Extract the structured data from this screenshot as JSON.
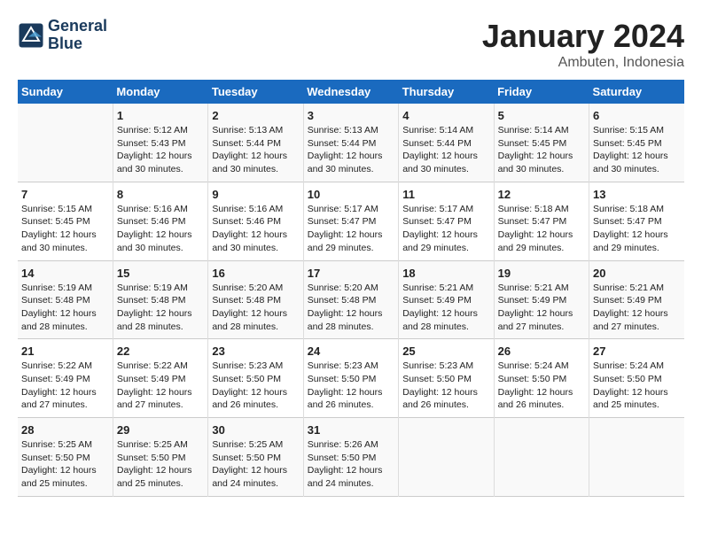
{
  "header": {
    "logo_line1": "General",
    "logo_line2": "Blue",
    "month": "January 2024",
    "location": "Ambuten, Indonesia"
  },
  "weekdays": [
    "Sunday",
    "Monday",
    "Tuesday",
    "Wednesday",
    "Thursday",
    "Friday",
    "Saturday"
  ],
  "weeks": [
    [
      {
        "day": "",
        "info": ""
      },
      {
        "day": "1",
        "info": "Sunrise: 5:12 AM\nSunset: 5:43 PM\nDaylight: 12 hours\nand 30 minutes."
      },
      {
        "day": "2",
        "info": "Sunrise: 5:13 AM\nSunset: 5:44 PM\nDaylight: 12 hours\nand 30 minutes."
      },
      {
        "day": "3",
        "info": "Sunrise: 5:13 AM\nSunset: 5:44 PM\nDaylight: 12 hours\nand 30 minutes."
      },
      {
        "day": "4",
        "info": "Sunrise: 5:14 AM\nSunset: 5:44 PM\nDaylight: 12 hours\nand 30 minutes."
      },
      {
        "day": "5",
        "info": "Sunrise: 5:14 AM\nSunset: 5:45 PM\nDaylight: 12 hours\nand 30 minutes."
      },
      {
        "day": "6",
        "info": "Sunrise: 5:15 AM\nSunset: 5:45 PM\nDaylight: 12 hours\nand 30 minutes."
      }
    ],
    [
      {
        "day": "7",
        "info": "Sunrise: 5:15 AM\nSunset: 5:45 PM\nDaylight: 12 hours\nand 30 minutes."
      },
      {
        "day": "8",
        "info": "Sunrise: 5:16 AM\nSunset: 5:46 PM\nDaylight: 12 hours\nand 30 minutes."
      },
      {
        "day": "9",
        "info": "Sunrise: 5:16 AM\nSunset: 5:46 PM\nDaylight: 12 hours\nand 30 minutes."
      },
      {
        "day": "10",
        "info": "Sunrise: 5:17 AM\nSunset: 5:47 PM\nDaylight: 12 hours\nand 29 minutes."
      },
      {
        "day": "11",
        "info": "Sunrise: 5:17 AM\nSunset: 5:47 PM\nDaylight: 12 hours\nand 29 minutes."
      },
      {
        "day": "12",
        "info": "Sunrise: 5:18 AM\nSunset: 5:47 PM\nDaylight: 12 hours\nand 29 minutes."
      },
      {
        "day": "13",
        "info": "Sunrise: 5:18 AM\nSunset: 5:47 PM\nDaylight: 12 hours\nand 29 minutes."
      }
    ],
    [
      {
        "day": "14",
        "info": "Sunrise: 5:19 AM\nSunset: 5:48 PM\nDaylight: 12 hours\nand 28 minutes."
      },
      {
        "day": "15",
        "info": "Sunrise: 5:19 AM\nSunset: 5:48 PM\nDaylight: 12 hours\nand 28 minutes."
      },
      {
        "day": "16",
        "info": "Sunrise: 5:20 AM\nSunset: 5:48 PM\nDaylight: 12 hours\nand 28 minutes."
      },
      {
        "day": "17",
        "info": "Sunrise: 5:20 AM\nSunset: 5:48 PM\nDaylight: 12 hours\nand 28 minutes."
      },
      {
        "day": "18",
        "info": "Sunrise: 5:21 AM\nSunset: 5:49 PM\nDaylight: 12 hours\nand 28 minutes."
      },
      {
        "day": "19",
        "info": "Sunrise: 5:21 AM\nSunset: 5:49 PM\nDaylight: 12 hours\nand 27 minutes."
      },
      {
        "day": "20",
        "info": "Sunrise: 5:21 AM\nSunset: 5:49 PM\nDaylight: 12 hours\nand 27 minutes."
      }
    ],
    [
      {
        "day": "21",
        "info": "Sunrise: 5:22 AM\nSunset: 5:49 PM\nDaylight: 12 hours\nand 27 minutes."
      },
      {
        "day": "22",
        "info": "Sunrise: 5:22 AM\nSunset: 5:49 PM\nDaylight: 12 hours\nand 27 minutes."
      },
      {
        "day": "23",
        "info": "Sunrise: 5:23 AM\nSunset: 5:50 PM\nDaylight: 12 hours\nand 26 minutes."
      },
      {
        "day": "24",
        "info": "Sunrise: 5:23 AM\nSunset: 5:50 PM\nDaylight: 12 hours\nand 26 minutes."
      },
      {
        "day": "25",
        "info": "Sunrise: 5:23 AM\nSunset: 5:50 PM\nDaylight: 12 hours\nand 26 minutes."
      },
      {
        "day": "26",
        "info": "Sunrise: 5:24 AM\nSunset: 5:50 PM\nDaylight: 12 hours\nand 26 minutes."
      },
      {
        "day": "27",
        "info": "Sunrise: 5:24 AM\nSunset: 5:50 PM\nDaylight: 12 hours\nand 25 minutes."
      }
    ],
    [
      {
        "day": "28",
        "info": "Sunrise: 5:25 AM\nSunset: 5:50 PM\nDaylight: 12 hours\nand 25 minutes."
      },
      {
        "day": "29",
        "info": "Sunrise: 5:25 AM\nSunset: 5:50 PM\nDaylight: 12 hours\nand 25 minutes."
      },
      {
        "day": "30",
        "info": "Sunrise: 5:25 AM\nSunset: 5:50 PM\nDaylight: 12 hours\nand 24 minutes."
      },
      {
        "day": "31",
        "info": "Sunrise: 5:26 AM\nSunset: 5:50 PM\nDaylight: 12 hours\nand 24 minutes."
      },
      {
        "day": "",
        "info": ""
      },
      {
        "day": "",
        "info": ""
      },
      {
        "day": "",
        "info": ""
      }
    ]
  ]
}
